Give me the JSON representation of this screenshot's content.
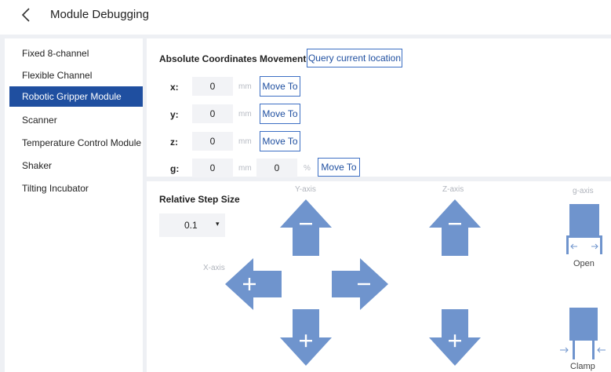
{
  "header": {
    "title": "Module Debugging",
    "back_icon": "chevron-left-icon"
  },
  "sidebar": {
    "items": [
      {
        "label": "Fixed 8-channel",
        "active": false
      },
      {
        "label": "Flexible Channel",
        "active": false
      },
      {
        "label": "Robotic Gripper Module",
        "active": true
      },
      {
        "label": "Scanner",
        "active": false
      },
      {
        "label": "Temperature Control Module",
        "active": false
      },
      {
        "label": "Shaker",
        "active": false
      },
      {
        "label": "Tilting Incubator",
        "active": false
      }
    ]
  },
  "absolute": {
    "title": "Absolute Coordinates Movement",
    "query_label": "Query current location",
    "rows": [
      {
        "label": "x:",
        "value": "0",
        "unit": "mm",
        "move_label": "Move To"
      },
      {
        "label": "y:",
        "value": "0",
        "unit": "mm",
        "move_label": "Move To"
      },
      {
        "label": "z:",
        "value": "0",
        "unit": "mm",
        "move_label": "Move To"
      }
    ],
    "g_row": {
      "label": "g:",
      "value": "0",
      "unit": "mm",
      "percent_value": "0",
      "percent_unit": "%",
      "move_label": "Move To"
    }
  },
  "relative": {
    "title": "Relative Step Size",
    "step_value": "0.1",
    "step_caret": "▾",
    "axes": {
      "y": "Y-axis",
      "z": "Z-axis",
      "g": "g-axis",
      "x": "X-axis"
    },
    "gripper": {
      "open_label": "Open",
      "clamp_label": "Clamp"
    }
  },
  "colors": {
    "accent": "#1f4fa0",
    "arrow": "#6f94cd",
    "background": "#eef0f4"
  }
}
